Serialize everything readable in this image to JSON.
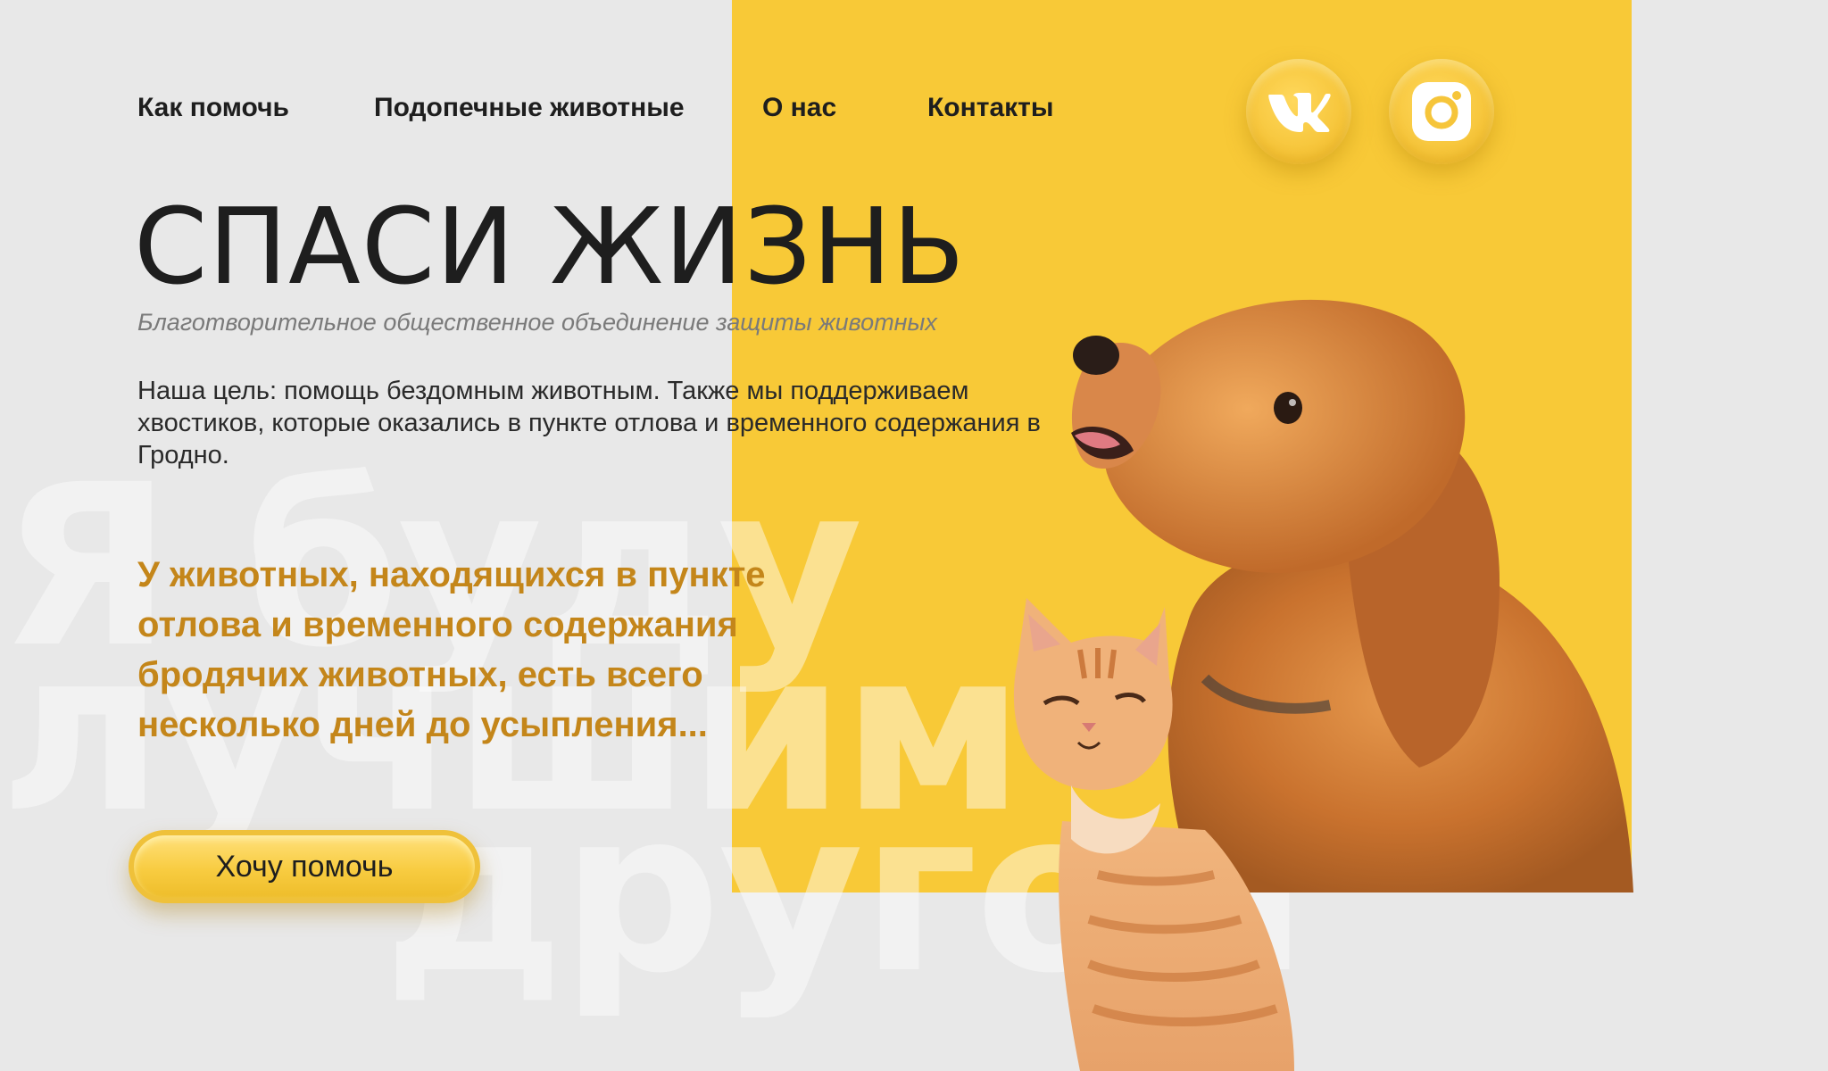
{
  "nav": {
    "items": [
      {
        "label": "Как помочь"
      },
      {
        "label": "Подопечные животные"
      },
      {
        "label": "О нас"
      },
      {
        "label": "Контакты"
      }
    ]
  },
  "social": {
    "vk_icon": "vk-icon",
    "instagram_icon": "instagram-icon"
  },
  "hero": {
    "title": "СПАСИ ЖИЗНЬ",
    "subtitle": "Благотворительное общественное объединение защиты животных",
    "description": "Наша цель: помощь бездомным животным. Также мы поддерживаем хвостиков, которые оказались в пункте отлова и временного содержания в Гродно.",
    "warning": "У животных, находящихся в пункте отлова и временного содержания бродячих животных, есть всего несколько дней до усыпления...",
    "cta_label": "Хочу помочь"
  },
  "watermark": {
    "line1": "Я буду",
    "line2": "лучшим",
    "line3": "другом"
  },
  "colors": {
    "accent_yellow": "#f8c937",
    "warning_text": "#c4861a",
    "background": "#e8e8e8"
  }
}
